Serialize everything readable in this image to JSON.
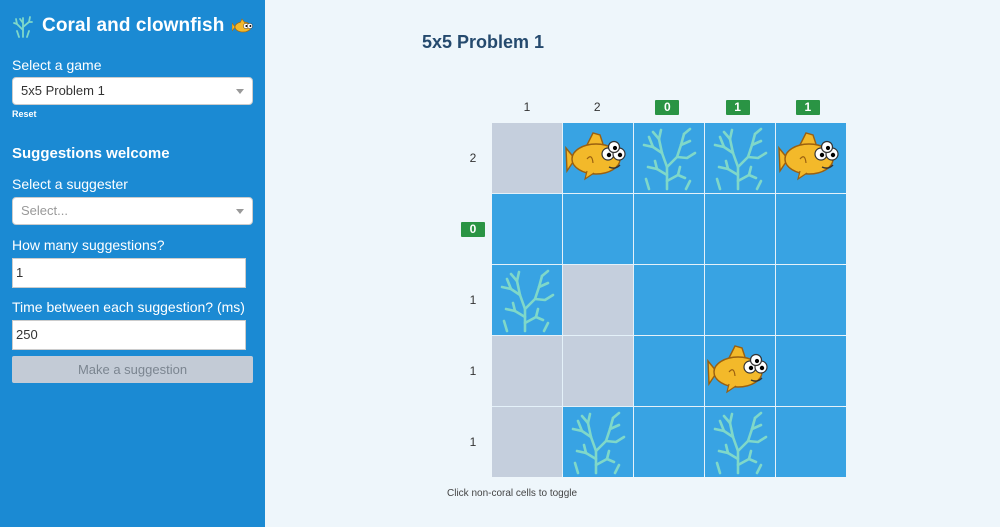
{
  "app": {
    "title": "Coral and clownfish",
    "logo_icon": "coral-icon",
    "mascot_icon": "clownfish-icon"
  },
  "sidebar": {
    "game_label": "Select a game",
    "game_value": "5x5 Problem 1",
    "reset_label": "Reset",
    "section_title": "Suggestions welcome",
    "suggester_label": "Select a suggester",
    "suggester_placeholder": "Select...",
    "count_label": "How many suggestions?",
    "count_value": "1",
    "time_label": "Time between each suggestion? (ms)",
    "time_value": "250",
    "button_label": "Make a suggestion"
  },
  "main": {
    "title": "5x5 Problem 1",
    "footer": "Click non-coral cells to toggle",
    "col_hints": [
      {
        "value": "1",
        "badge": false
      },
      {
        "value": "2",
        "badge": false
      },
      {
        "value": "0",
        "badge": true
      },
      {
        "value": "1",
        "badge": true
      },
      {
        "value": "1",
        "badge": true
      }
    ],
    "row_hints": [
      {
        "value": "2",
        "badge": false
      },
      {
        "value": "0",
        "badge": true
      },
      {
        "value": "1",
        "badge": false
      },
      {
        "value": "1",
        "badge": false
      },
      {
        "value": "1",
        "badge": false
      }
    ],
    "grid": [
      [
        "grey",
        "fish",
        "coral",
        "coral",
        "fish"
      ],
      [
        "water",
        "water",
        "water",
        "water",
        "water"
      ],
      [
        "coral",
        "grey",
        "water",
        "water",
        "water"
      ],
      [
        "grey",
        "grey",
        "water",
        "fish",
        "water"
      ],
      [
        "grey",
        "coral",
        "water",
        "coral",
        "water"
      ]
    ]
  },
  "colors": {
    "sidebar": "#1b8ad3",
    "water": "#38a3e3",
    "grey": "#c5cfdd",
    "badge": "#2a9444",
    "coral": "#7fd8c9",
    "fish": "#f3b92a"
  }
}
